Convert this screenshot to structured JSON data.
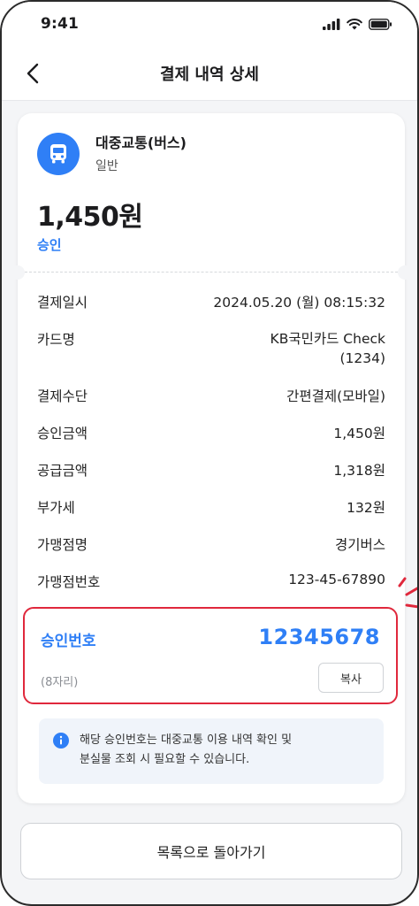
{
  "status_bar": {
    "time": "9:41"
  },
  "header": {
    "title": "결제 내역 상세"
  },
  "merchant": {
    "name": "대중교통(버스)",
    "type": "일반",
    "amount": "1,450원",
    "status": "승인"
  },
  "details": [
    {
      "label": "결제일시",
      "value": "2024.05.20 (월) 08:15:32"
    },
    {
      "label": "카드명",
      "value": "KB국민카드 Check",
      "value2": "(1234)"
    },
    {
      "label": "결제수단",
      "value": "간편결제(모바일)"
    },
    {
      "label": "승인금액",
      "value": "1,450원"
    },
    {
      "label": "공급금액",
      "value": "1,318원"
    },
    {
      "label": "부가세",
      "value": "132원"
    },
    {
      "label": "가맹점명",
      "value": "경기버스"
    },
    {
      "label": "가맹점번호",
      "value": "123-45-67890"
    }
  ],
  "approval": {
    "label": "승인번호",
    "number": "12345678",
    "digits": "(8자리)",
    "copy_label": "복사"
  },
  "info": {
    "line1": "해당 승인번호는 대중교통 이용 내역 확인 및",
    "line2": "분실물 조회 시 필요할 수 있습니다."
  },
  "footer": {
    "button_label": "목록으로 돌아가기"
  },
  "colors": {
    "accent": "#2f7ff6",
    "highlight_border": "#e0283c",
    "info_bg": "#f0f4fa"
  },
  "icons": [
    "back-arrow-icon",
    "bus-icon",
    "signal-icon",
    "wifi-icon",
    "battery-icon",
    "info-icon"
  ]
}
